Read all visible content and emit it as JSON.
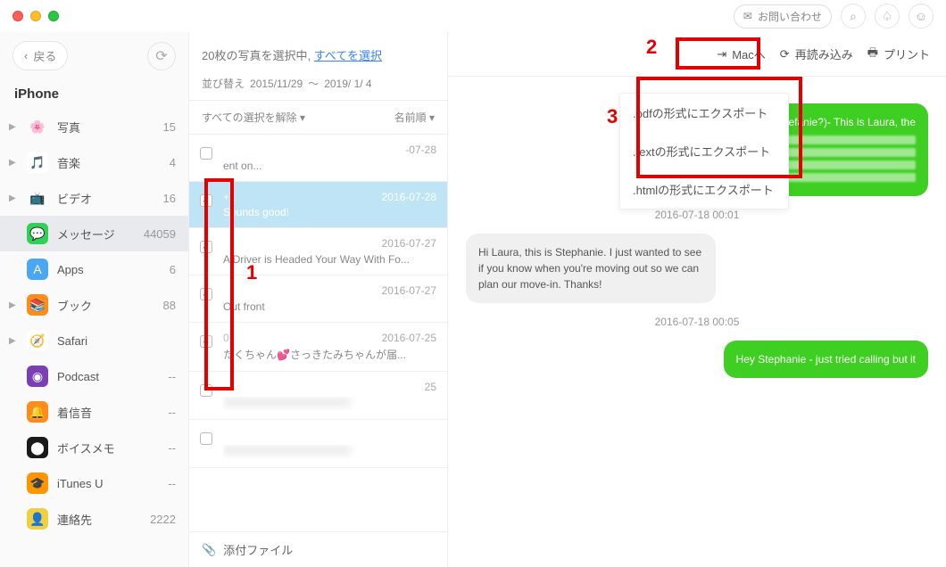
{
  "titlebar": {
    "contact_label": "お問い合わせ"
  },
  "sidebar": {
    "back_label": "戻る",
    "device": "iPhone",
    "items": [
      {
        "label": "写真",
        "count": "15",
        "icon_bg": "",
        "icon_txt": "🌸",
        "expandable": true
      },
      {
        "label": "音楽",
        "count": "4",
        "icon_bg": "#fff",
        "icon_txt": "🎵",
        "expandable": true
      },
      {
        "label": "ビデオ",
        "count": "16",
        "icon_bg": "",
        "icon_txt": "📺",
        "expandable": true
      },
      {
        "label": "メッセージ",
        "count": "44059",
        "icon_bg": "#31d158",
        "icon_txt": "💬",
        "expandable": false
      },
      {
        "label": "Apps",
        "count": "6",
        "icon_bg": "#4aa7f0",
        "icon_txt": "A",
        "expandable": false
      },
      {
        "label": "ブック",
        "count": "88",
        "icon_bg": "#ff8c1a",
        "icon_txt": "📚",
        "expandable": true
      },
      {
        "label": "Safari",
        "count": "",
        "icon_bg": "#fff",
        "icon_txt": "🧭",
        "expandable": true
      },
      {
        "label": "Podcast",
        "count": "--",
        "icon_bg": "#7b3fb5",
        "icon_txt": "◉",
        "expandable": false
      },
      {
        "label": "着信音",
        "count": "--",
        "icon_bg": "#ff8c1a",
        "icon_txt": "🔔",
        "expandable": false
      },
      {
        "label": "ボイスメモ",
        "count": "--",
        "icon_bg": "#1a1a1a",
        "icon_txt": "⬤",
        "expandable": false
      },
      {
        "label": "iTunes U",
        "count": "--",
        "icon_bg": "#ff9500",
        "icon_txt": "🎓",
        "expandable": false
      },
      {
        "label": "連絡先",
        "count": "2222",
        "icon_bg": "#f0d040",
        "icon_txt": "👤",
        "expandable": false
      }
    ]
  },
  "center": {
    "selection_prefix": "20枚の写真を選択中, ",
    "select_all": "すべてを選択",
    "sort_label": "並び替え",
    "date_from": "2015/11/29",
    "date_sep": "～",
    "date_to": "2019/ 1/ 4",
    "deselect_all": "すべての選択を解除",
    "sort_name": "名前順",
    "items": [
      {
        "checked": false,
        "date": "-07-28",
        "preview": "ent on..."
      },
      {
        "checked": true,
        "title": "+1",
        "date": "2016-07-28",
        "preview": "Sounds good!"
      },
      {
        "checked": true,
        "date": "2016-07-27",
        "preview": "A Driver is Headed Your Way With Fo..."
      },
      {
        "checked": true,
        "date": "2016-07-27",
        "preview": "Out front"
      },
      {
        "checked": true,
        "title": "0",
        "date": "2016-07-25",
        "preview": "たくちゃん💕さっきたみちゃんが届..."
      },
      {
        "checked": false,
        "date": "25",
        "preview": ""
      },
      {
        "checked": false,
        "date": "",
        "preview": ""
      }
    ],
    "attachments_label": "添付ファイル"
  },
  "right": {
    "toolbar": {
      "mac_label": "Macへ",
      "reload_label": "再読み込み",
      "print_label": "プリント"
    },
    "export_options": [
      ".pdfの形式にエクスポート",
      ".textの形式にエクスポート",
      ".htmlの形式にエクスポート"
    ],
    "conversation": {
      "msg1": "Hi Stephanie (Stefanie?)- This is Laura, the",
      "ts1": "2016-07-18 00:01",
      "msg2": "Hi Laura, this is Stephanie.  I just wanted to see if you know when you're moving out so we can plan our move-in. Thanks!",
      "ts2": "2016-07-18 00:05",
      "msg3": "Hey Stephanie - just tried calling but it"
    }
  },
  "annotations": {
    "n1": "1",
    "n2": "2",
    "n3": "3"
  }
}
